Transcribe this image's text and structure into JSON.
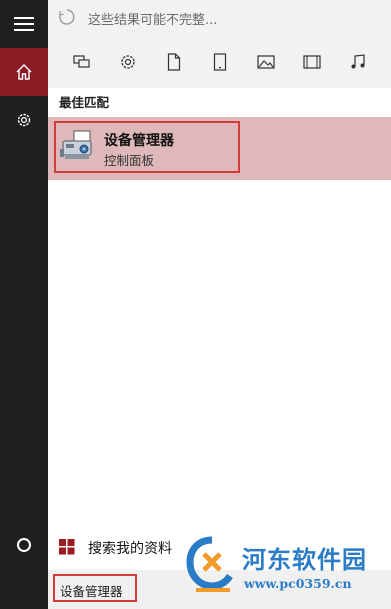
{
  "status": {
    "text": "这些结果可能不完整..."
  },
  "section": {
    "best_match": "最佳匹配"
  },
  "result": {
    "title": "设备管理器",
    "subtitle": "控制面板"
  },
  "search_mine": {
    "label": "搜索我的资料"
  },
  "query": {
    "value": "设备管理器"
  },
  "watermark": {
    "brand": "河东软件园",
    "url": "www.pc0359.cn"
  },
  "filters": [
    "apps-icon",
    "settings-icon",
    "documents-icon",
    "tablet-icon",
    "photos-icon",
    "videos-icon",
    "music-icon"
  ],
  "colors": {
    "sidebar": "#1f1f1f",
    "home_active": "#8a1c25",
    "result_bg": "#deb8ba",
    "outline": "#d53b3b",
    "watermark": "#2b7cc7"
  }
}
